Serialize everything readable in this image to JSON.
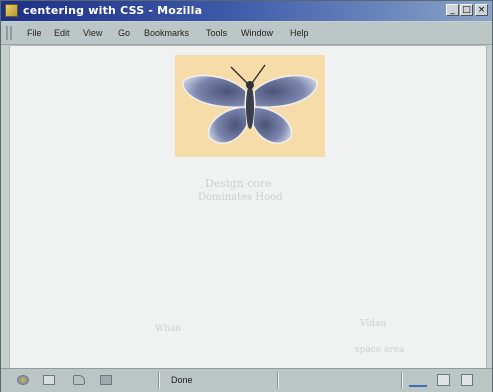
{
  "window": {
    "title": "centering with CSS - Mozilla",
    "controls": {
      "minimize": "_",
      "maximize": "□",
      "close": "×"
    }
  },
  "menubar": {
    "items": [
      {
        "label": "File"
      },
      {
        "label": "Edit"
      },
      {
        "label": "View"
      },
      {
        "label": "Go"
      },
      {
        "label": "Bookmarks"
      },
      {
        "label": "Tools"
      },
      {
        "label": "Window"
      },
      {
        "label": "Help"
      }
    ]
  },
  "content": {
    "image": {
      "subject": "butterfly",
      "background_color": "#f5dca8"
    },
    "ghost_text": [
      "Design core",
      "Dominates Hood",
      "Vidan",
      "Whao",
      "space area"
    ]
  },
  "statusbar": {
    "status": "Done",
    "icons": [
      "navigator-icon",
      "mail-icon",
      "composer-icon",
      "address-book-icon",
      "online-icon",
      "security-icon"
    ]
  },
  "colors": {
    "titlebar_start": "#1d2f86",
    "titlebar_end": "#8aa4c8",
    "chrome": "#c7d0cf",
    "content_bg": "#eff2f0"
  }
}
